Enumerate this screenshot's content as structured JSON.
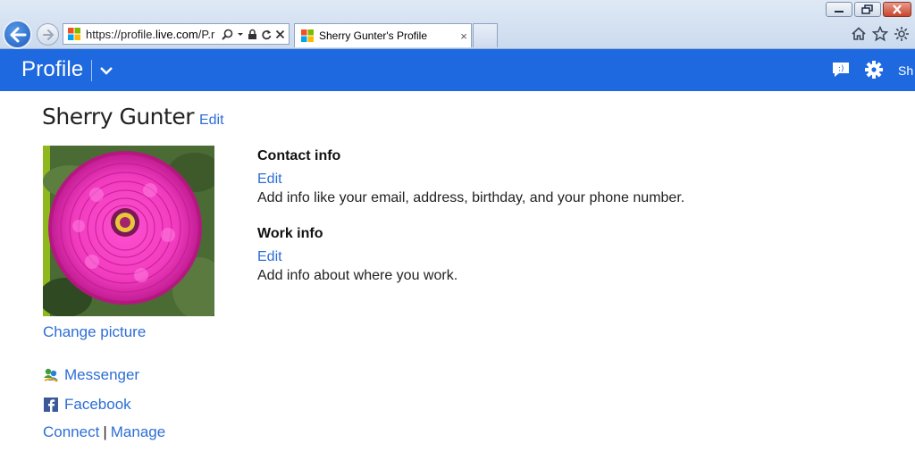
{
  "browser": {
    "address": {
      "url_prefix": "https://profile.",
      "url_domain": "live.com",
      "url_suffix": "/P.r"
    },
    "tab": {
      "title": "Sherry Gunter's Profile",
      "close": "×"
    },
    "icons": [
      "back-arrow-icon",
      "forward-arrow-icon",
      "ie-logo-icon",
      "search-icon",
      "lock-icon",
      "refresh-icon",
      "stop-icon",
      "home-icon",
      "favorites-star-icon",
      "tools-gear-icon"
    ],
    "window_controls": [
      "minimize",
      "restore",
      "close"
    ]
  },
  "appbar": {
    "title": "Profile",
    "user_label": "Sh",
    "color": "#1f69e0"
  },
  "profile": {
    "name": "Sherry Gunter",
    "name_edit": "Edit",
    "change_picture": "Change picture",
    "social": [
      {
        "label": "Messenger",
        "icon": "messenger-icon"
      },
      {
        "label": "Facebook",
        "icon": "facebook-icon"
      }
    ],
    "connect": "Connect",
    "separator": "|",
    "manage": "Manage"
  },
  "contact_info": {
    "title": "Contact info",
    "edit": "Edit",
    "description": "Add info like your email, address, birthday, and your phone number."
  },
  "work_info": {
    "title": "Work info",
    "edit": "Edit",
    "description": "Add info about where you work."
  },
  "colors": {
    "link": "#2d6ed6",
    "header": "#1f69e0"
  }
}
